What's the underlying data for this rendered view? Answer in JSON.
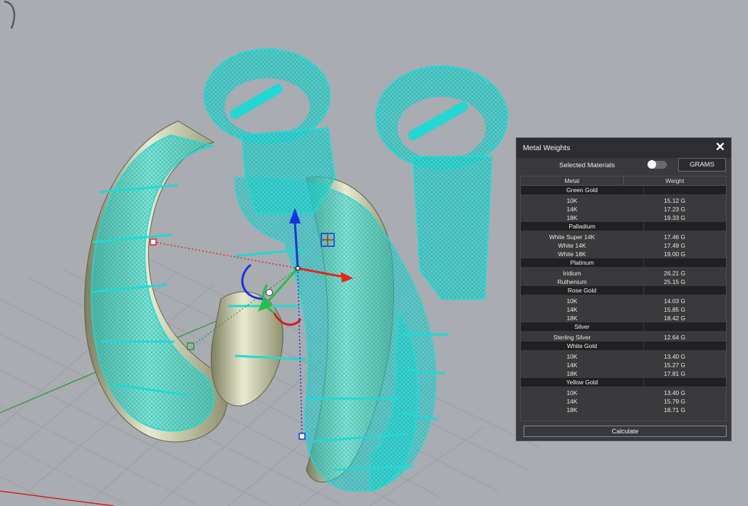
{
  "panel": {
    "title": "Metal Weights",
    "selected_materials_label": "Selected Materials",
    "toggle_on": false,
    "units_button": "GRAMS",
    "columns": [
      "Metal",
      "Weight"
    ],
    "groups": [
      {
        "name": "Green Gold",
        "items": [
          {
            "metal": "10K",
            "weight": "15.12 G"
          },
          {
            "metal": "14K",
            "weight": "17.23 G"
          },
          {
            "metal": "18K",
            "weight": "19.33 G"
          }
        ]
      },
      {
        "name": "Palladium",
        "items": [
          {
            "metal": "White Super 14K",
            "weight": "17.46 G"
          },
          {
            "metal": "White 14K",
            "weight": "17.49 G"
          },
          {
            "metal": "White 18K",
            "weight": "19.00 G"
          }
        ]
      },
      {
        "name": "Platinum",
        "items": [
          {
            "metal": "Iridium",
            "weight": "26.21 G"
          },
          {
            "metal": "Ruthenium",
            "weight": "25.15 G"
          }
        ]
      },
      {
        "name": "Rose Gold",
        "items": [
          {
            "metal": "10K",
            "weight": "14.03 G"
          },
          {
            "metal": "14K",
            "weight": "15.85 G"
          },
          {
            "metal": "18K",
            "weight": "18.42 G"
          }
        ]
      },
      {
        "name": "Silver",
        "items": [
          {
            "metal": "Sterling Silver",
            "weight": "12.64 G"
          }
        ]
      },
      {
        "name": "White Gold",
        "items": [
          {
            "metal": "10K",
            "weight": "13.40 G"
          },
          {
            "metal": "14K",
            "weight": "15.27 G"
          },
          {
            "metal": "18K",
            "weight": "17.81 G"
          }
        ]
      },
      {
        "name": "Yellow Gold",
        "items": [
          {
            "metal": "10K",
            "weight": "13.40 G"
          },
          {
            "metal": "14K",
            "weight": "15.79 G"
          },
          {
            "metal": "18K",
            "weight": "18.71 G"
          }
        ]
      }
    ],
    "calculate_button": "Calculate"
  },
  "colors": {
    "viewport_bg": "#a9acb1",
    "wireframe": "#22d8d4",
    "metal": "#c9c9a6",
    "panel_bg": "#3a3a3c",
    "group_bg": "#202022",
    "axis_x": "#e8241c",
    "axis_y": "#22c24a",
    "axis_z": "#1533e6"
  },
  "icons": {
    "close": "close-icon",
    "gizmo": "gumball-gizmo-icon"
  }
}
